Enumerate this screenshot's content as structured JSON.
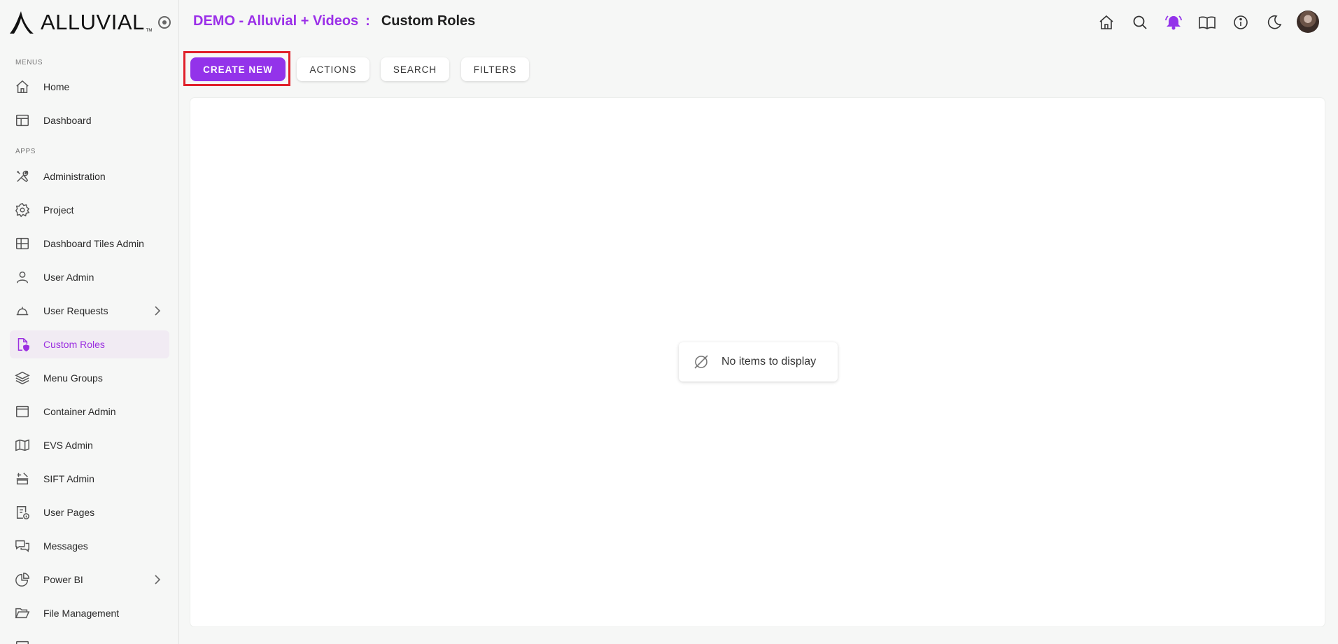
{
  "app": {
    "logo_text": "ALLUVIAL",
    "logo_tm": "TM"
  },
  "sidebar": {
    "sections": {
      "menus": "MENUS",
      "apps": "APPS"
    },
    "menus": [
      {
        "label": "Home",
        "icon": "home-icon"
      },
      {
        "label": "Dashboard",
        "icon": "dashboard-icon"
      }
    ],
    "apps": [
      {
        "label": "Administration",
        "icon": "tools-icon"
      },
      {
        "label": "Project",
        "icon": "gear-icon"
      },
      {
        "label": "Dashboard Tiles Admin",
        "icon": "grid-icon"
      },
      {
        "label": "User Admin",
        "icon": "user-icon"
      },
      {
        "label": "User Requests",
        "icon": "bell-service-icon",
        "has_children": true
      },
      {
        "label": "Custom Roles",
        "icon": "file-shield-icon",
        "active": true
      },
      {
        "label": "Menu Groups",
        "icon": "layers-icon"
      },
      {
        "label": "Container Admin",
        "icon": "window-icon"
      },
      {
        "label": "EVS Admin",
        "icon": "map-icon"
      },
      {
        "label": "SIFT Admin",
        "icon": "sift-icon"
      },
      {
        "label": "User Pages",
        "icon": "page-info-icon"
      },
      {
        "label": "Messages",
        "icon": "chat-icon"
      },
      {
        "label": "Power BI",
        "icon": "pie-chart-icon",
        "has_children": true
      },
      {
        "label": "File Management",
        "icon": "folder-open-icon"
      }
    ]
  },
  "header": {
    "project": "DEMO - Alluvial + Videos",
    "separator": ":",
    "page_title": "Custom Roles"
  },
  "toolbar": {
    "create_new": "CREATE NEW",
    "actions": "ACTIONS",
    "search": "SEARCH",
    "filters": "FILTERS"
  },
  "empty_state": {
    "message": "No items to display"
  },
  "colors": {
    "accent": "#9333ea",
    "highlight": "#e0202a"
  }
}
